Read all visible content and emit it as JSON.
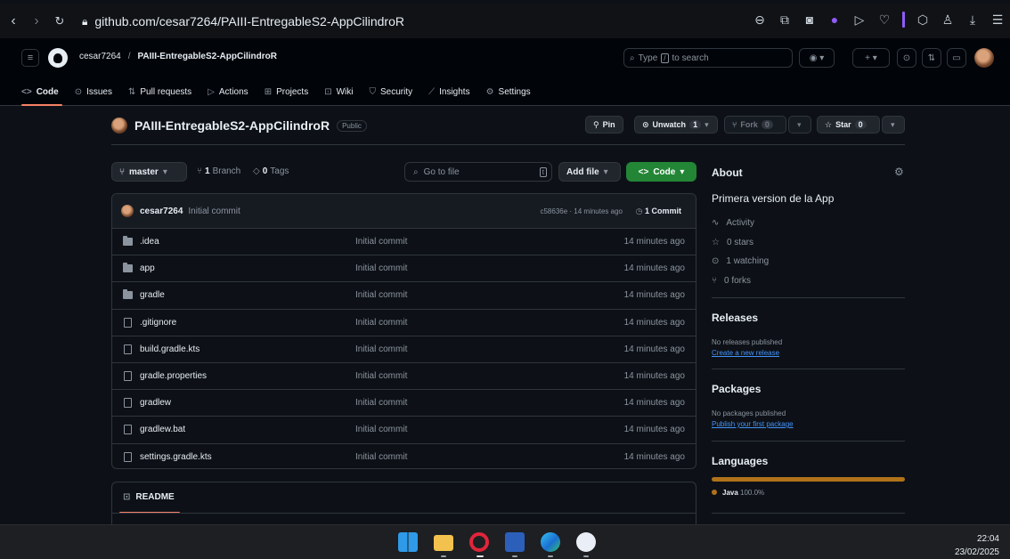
{
  "browser": {
    "url": "github.com/cesar7264/PAIII-EntregableS2-AppCilindroR",
    "icons": [
      "back-icon",
      "forward-icon",
      "reload-icon",
      "lock-icon",
      "zoom-icon",
      "screenshot-icon",
      "camera-icon",
      "shield-icon",
      "play-icon",
      "heart-icon",
      "cube-icon",
      "profile-icon",
      "download-icon",
      "menu-icon"
    ]
  },
  "header": {
    "owner": "cesar7264",
    "separator": "/",
    "repo": "PAIII-EntregableS2-AppCilindroR",
    "search_prefix": "Type",
    "search_key": "/",
    "search_suffix": "to search",
    "tabs": [
      {
        "label": "Code",
        "icon": "<>"
      },
      {
        "label": "Issues",
        "icon": "⊙"
      },
      {
        "label": "Pull requests",
        "icon": "⇅"
      },
      {
        "label": "Actions",
        "icon": "▷"
      },
      {
        "label": "Projects",
        "icon": "⊞"
      },
      {
        "label": "Wiki",
        "icon": "⊡"
      },
      {
        "label": "Security",
        "icon": "⛉"
      },
      {
        "label": "Insights",
        "icon": "⟋"
      },
      {
        "label": "Settings",
        "icon": "⚙"
      }
    ]
  },
  "repo": {
    "name": "PAIII-EntregableS2-AppCilindroR",
    "visibility": "Public",
    "pin": "Pin",
    "unwatch": "Unwatch",
    "watch_count": "1",
    "fork": "Fork",
    "fork_count": "0",
    "star": "Star",
    "star_count": "0"
  },
  "branch_bar": {
    "branch": "master",
    "branches_count": "1",
    "branches_label": "Branch",
    "tags_count": "0",
    "tags_label": "Tags",
    "goto_placeholder": "Go to file",
    "goto_key": "t",
    "add_file": "Add file",
    "code": "Code"
  },
  "commit": {
    "author": "cesar7264",
    "message": "Initial commit",
    "sha_time": "c58636e · 14 minutes ago",
    "count": "1 Commit"
  },
  "files": [
    {
      "name": ".idea",
      "type": "dir",
      "message": "Initial commit",
      "time": "14 minutes ago"
    },
    {
      "name": "app",
      "type": "dir",
      "message": "Initial commit",
      "time": "14 minutes ago"
    },
    {
      "name": "gradle",
      "type": "dir",
      "message": "Initial commit",
      "time": "14 minutes ago"
    },
    {
      "name": ".gitignore",
      "type": "file",
      "message": "Initial commit",
      "time": "14 minutes ago"
    },
    {
      "name": "build.gradle.kts",
      "type": "file",
      "message": "Initial commit",
      "time": "14 minutes ago"
    },
    {
      "name": "gradle.properties",
      "type": "file",
      "message": "Initial commit",
      "time": "14 minutes ago"
    },
    {
      "name": "gradlew",
      "type": "file",
      "message": "Initial commit",
      "time": "14 minutes ago"
    },
    {
      "name": "gradlew.bat",
      "type": "file",
      "message": "Initial commit",
      "time": "14 minutes ago"
    },
    {
      "name": "settings.gradle.kts",
      "type": "file",
      "message": "Initial commit",
      "time": "14 minutes ago"
    }
  ],
  "readme": {
    "label": "README"
  },
  "about": {
    "title": "About",
    "description": "Primera version de la App",
    "activity": "Activity",
    "stars": "0 stars",
    "watching": "1 watching",
    "forks": "0 forks"
  },
  "releases": {
    "title": "Releases",
    "none": "No releases published",
    "link": "Create a new release"
  },
  "packages": {
    "title": "Packages",
    "none": "No packages published",
    "link": "Publish your first package"
  },
  "languages": {
    "title": "Languages",
    "name": "Java",
    "percent": "100.0%",
    "color": "#b07219"
  },
  "taskbar": {
    "time": "22:04",
    "date": "23/02/2025"
  },
  "colors": {
    "accent_green": "#238636",
    "tab_underline": "#f78166",
    "link": "#4493f8",
    "bg": "#0d1117"
  }
}
